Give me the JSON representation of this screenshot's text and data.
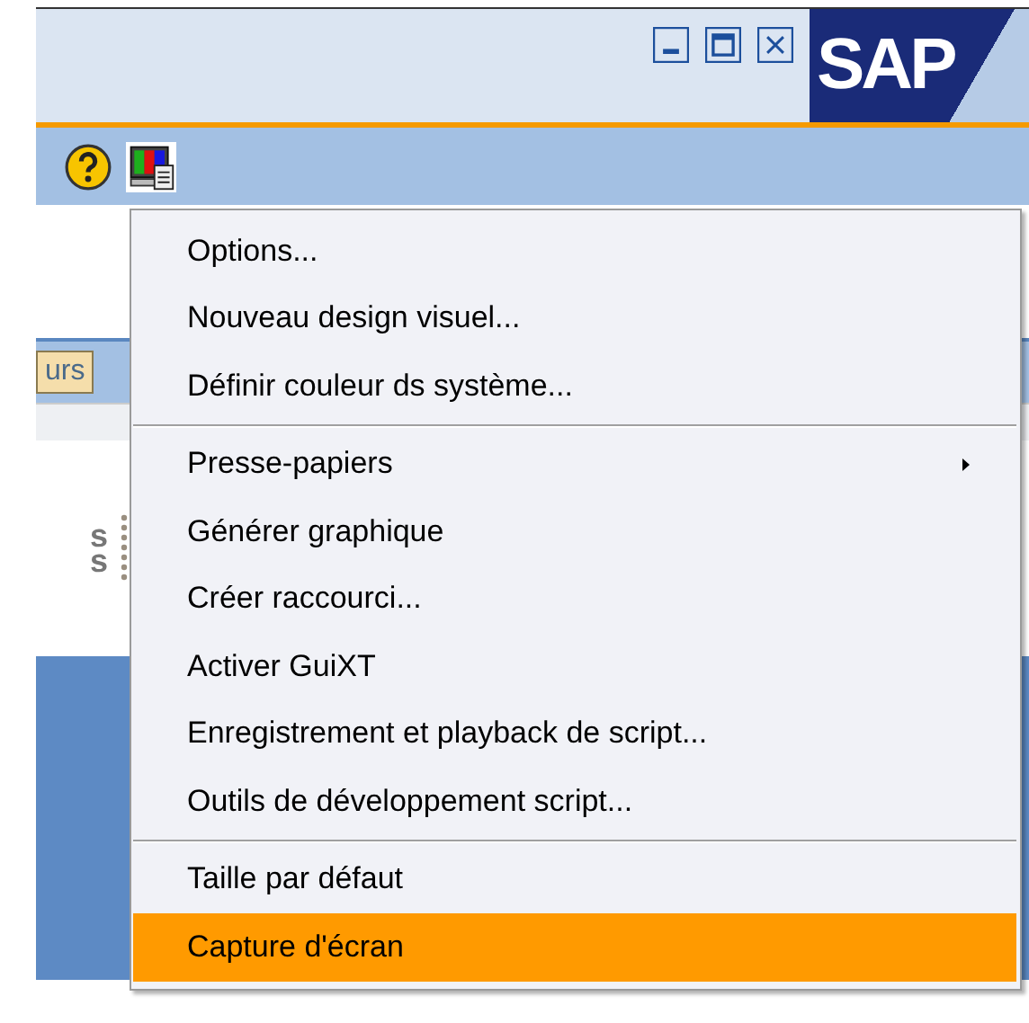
{
  "title_bar": {
    "logo": "SAP"
  },
  "background": {
    "button_fragment": "urs",
    "logo_fragment": [
      "s",
      "s"
    ]
  },
  "menu": {
    "items": [
      {
        "kind": "item",
        "label": "Options...",
        "submenu": false,
        "selected": false
      },
      {
        "kind": "item",
        "label": "Nouveau design visuel...",
        "submenu": false,
        "selected": false
      },
      {
        "kind": "item",
        "label": "Définir couleur ds système...",
        "submenu": false,
        "selected": false
      },
      {
        "kind": "separator"
      },
      {
        "kind": "item",
        "label": "Presse-papiers",
        "submenu": true,
        "selected": false
      },
      {
        "kind": "item",
        "label": "Générer graphique",
        "submenu": false,
        "selected": false
      },
      {
        "kind": "item",
        "label": "Créer raccourci...",
        "submenu": false,
        "selected": false
      },
      {
        "kind": "item",
        "label": "Activer GuiXT",
        "submenu": false,
        "selected": false
      },
      {
        "kind": "item",
        "label": "Enregistrement et playback de script...",
        "submenu": false,
        "selected": false
      },
      {
        "kind": "item",
        "label": "Outils de développement script...",
        "submenu": false,
        "selected": false
      },
      {
        "kind": "separator"
      },
      {
        "kind": "item",
        "label": "Taille par défaut",
        "submenu": false,
        "selected": false
      },
      {
        "kind": "item",
        "label": "Capture d'écran",
        "submenu": false,
        "selected": true
      }
    ]
  }
}
